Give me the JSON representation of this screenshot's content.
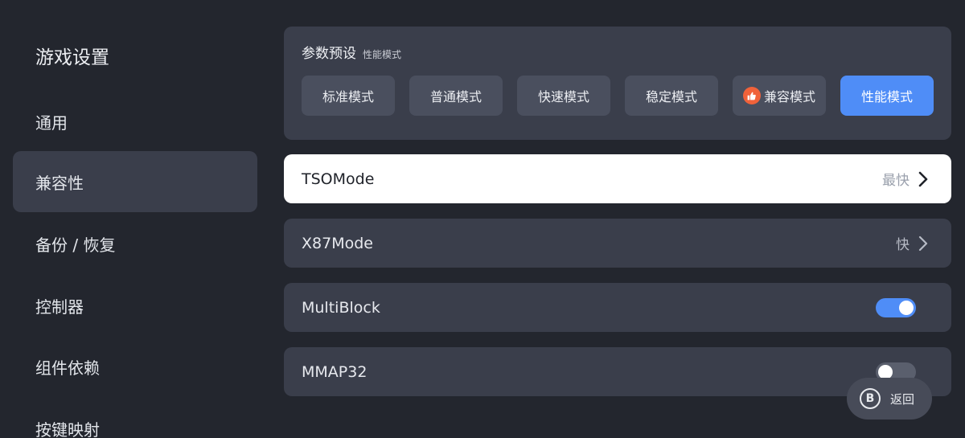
{
  "sidebar": {
    "title": "游戏设置",
    "items": [
      {
        "label": "通用"
      },
      {
        "label": "兼容性"
      },
      {
        "label": "备份 / 恢复"
      },
      {
        "label": "控制器"
      },
      {
        "label": "组件依赖"
      },
      {
        "label": "按键映射"
      }
    ]
  },
  "preset": {
    "title": "参数预设",
    "current": "性能模式",
    "buttons": [
      {
        "label": "标准模式"
      },
      {
        "label": "普通模式"
      },
      {
        "label": "快速模式"
      },
      {
        "label": "稳定模式"
      },
      {
        "label": "兼容模式",
        "icon": "thumbs-up-icon"
      },
      {
        "label": "性能模式"
      }
    ]
  },
  "rows": [
    {
      "label": "TSOMode",
      "value": "最快"
    },
    {
      "label": "X87Mode",
      "value": "快"
    },
    {
      "label": "MultiBlock",
      "toggle": true
    },
    {
      "label": "MMAP32",
      "toggle": false
    }
  ],
  "back": {
    "key": "B",
    "label": "返回"
  },
  "colors": {
    "accent": "#4f8df7",
    "badge": "#f0623a"
  }
}
